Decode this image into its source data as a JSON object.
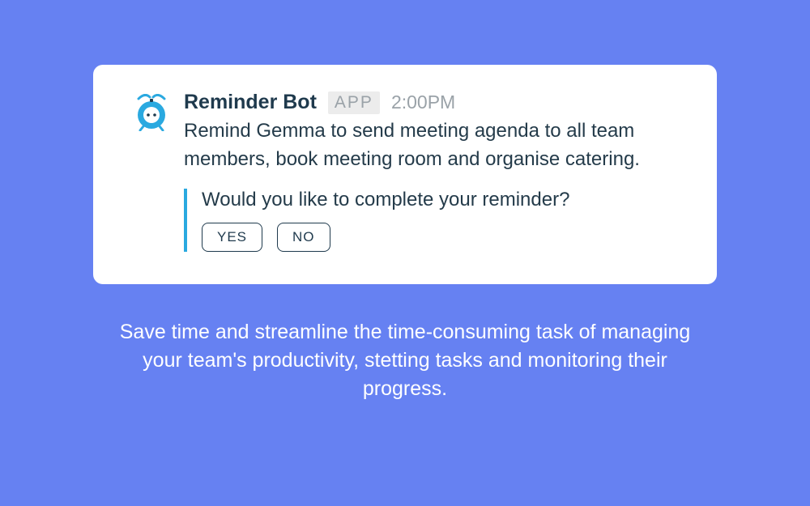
{
  "card": {
    "bot_name": "Reminder Bot",
    "app_badge": "APP",
    "timestamp": "2:00PM",
    "message": "Remind Gemma to send meeting agenda to all team members, book meeting room and organise catering.",
    "prompt": "Would you like to complete your reminder?",
    "buttons": {
      "yes": "YES",
      "no": "NO"
    }
  },
  "tagline": "Save time and streamline the time-consuming task of managing your team's productivity, stetting tasks and monitoring their progress.",
  "colors": {
    "background": "#6681f2",
    "accent": "#2aa9e0",
    "text_dark": "#1f3a4d",
    "muted": "#9aa2a8"
  }
}
